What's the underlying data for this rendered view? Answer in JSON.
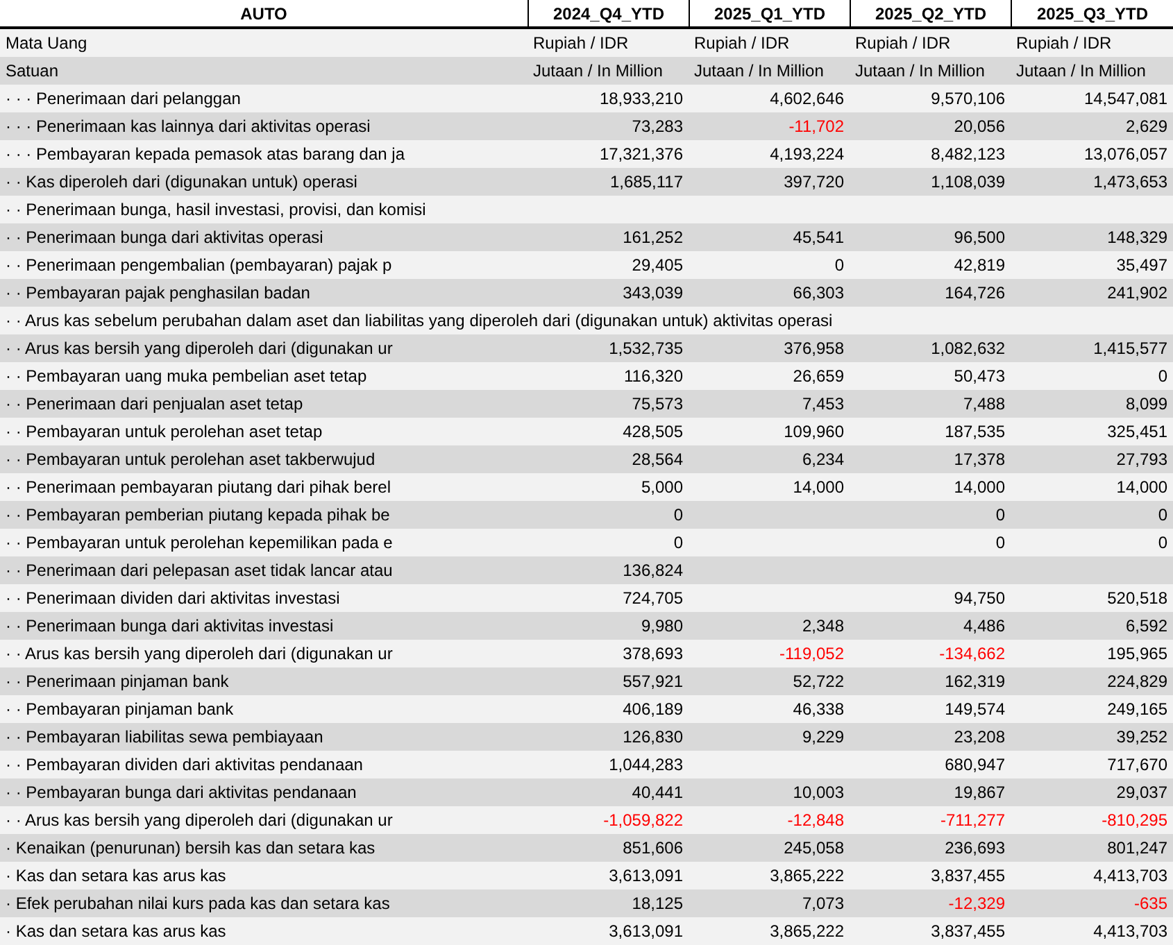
{
  "table": {
    "columns": [
      "AUTO",
      "2024_Q4_YTD",
      "2025_Q1_YTD",
      "2025_Q2_YTD",
      "2025_Q3_YTD"
    ],
    "meta_rows": [
      {
        "label": "Mata Uang",
        "values": [
          "Rupiah / IDR",
          "Rupiah / IDR",
          "Rupiah / IDR",
          "Rupiah / IDR"
        ]
      },
      {
        "label": "Satuan",
        "values": [
          "Jutaan / In Million",
          "Jutaan / In Million",
          "Jutaan / In Million",
          "Jutaan / In Million"
        ]
      }
    ],
    "rows": [
      {
        "label": "· · · Penerimaan dari pelanggan",
        "values": {
          "column_1": {
            "text": "18,933,210",
            "negative": false
          },
          "column_2": {
            "text": "4,602,646",
            "negative": false
          },
          "column_3": {
            "text": "9,570,106",
            "negative": false
          },
          "column_4": {
            "text": "14,547,081",
            "negative": false
          }
        }
      },
      {
        "label": "· · · Penerimaan kas lainnya dari aktivitas operasi",
        "values": {
          "column_1": {
            "text": "73,283",
            "negative": false
          },
          "column_2": {
            "text": "-11,702",
            "negative": true
          },
          "column_3": {
            "text": "20,056",
            "negative": false
          },
          "column_4": {
            "text": "2,629",
            "negative": false
          }
        }
      },
      {
        "label": "· · · Pembayaran kepada pemasok atas barang dan ja",
        "values": {
          "column_1": {
            "text": "17,321,376",
            "negative": false
          },
          "column_2": {
            "text": "4,193,224",
            "negative": false
          },
          "column_3": {
            "text": "8,482,123",
            "negative": false
          },
          "column_4": {
            "text": "13,076,057",
            "negative": false
          }
        }
      },
      {
        "label": "· · Kas diperoleh dari (digunakan untuk) operasi",
        "values": {
          "column_1": {
            "text": "1,685,117",
            "negative": false
          },
          "column_2": {
            "text": "397,720",
            "negative": false
          },
          "column_3": {
            "text": "1,108,039",
            "negative": false
          },
          "column_4": {
            "text": "1,473,653",
            "negative": false
          }
        }
      },
      {
        "label": "· · Penerimaan bunga, hasil investasi, provisi, dan komisi"
      },
      {
        "label": "· · Penerimaan bunga dari aktivitas operasi",
        "values": {
          "column_1": {
            "text": "161,252",
            "negative": false
          },
          "column_2": {
            "text": "45,541",
            "negative": false
          },
          "column_3": {
            "text": "96,500",
            "negative": false
          },
          "column_4": {
            "text": "148,329",
            "negative": false
          }
        }
      },
      {
        "label": "· · Penerimaan pengembalian (pembayaran) pajak p",
        "values": {
          "column_1": {
            "text": "29,405",
            "negative": false
          },
          "column_2": {
            "text": "0",
            "negative": false
          },
          "column_3": {
            "text": "42,819",
            "negative": false
          },
          "column_4": {
            "text": "35,497",
            "negative": false
          }
        }
      },
      {
        "label": "· · Pembayaran pajak penghasilan badan",
        "values": {
          "column_1": {
            "text": "343,039",
            "negative": false
          },
          "column_2": {
            "text": "66,303",
            "negative": false
          },
          "column_3": {
            "text": "164,726",
            "negative": false
          },
          "column_4": {
            "text": "241,902",
            "negative": false
          }
        }
      },
      {
        "label": "· · Arus kas sebelum perubahan dalam aset dan liabilitas yang diperoleh dari (digunakan untuk) aktivitas operasi"
      },
      {
        "label": "· · Arus kas bersih yang diperoleh dari (digunakan ur",
        "values": {
          "column_1": {
            "text": "1,532,735",
            "negative": false
          },
          "column_2": {
            "text": "376,958",
            "negative": false
          },
          "column_3": {
            "text": "1,082,632",
            "negative": false
          },
          "column_4": {
            "text": "1,415,577",
            "negative": false
          }
        }
      },
      {
        "label": "· · Pembayaran uang muka pembelian aset tetap",
        "values": {
          "column_1": {
            "text": "116,320",
            "negative": false
          },
          "column_2": {
            "text": "26,659",
            "negative": false
          },
          "column_3": {
            "text": "50,473",
            "negative": false
          },
          "column_4": {
            "text": "0",
            "negative": false
          }
        }
      },
      {
        "label": "· · Penerimaan dari penjualan aset tetap",
        "values": {
          "column_1": {
            "text": "75,573",
            "negative": false
          },
          "column_2": {
            "text": "7,453",
            "negative": false
          },
          "column_3": {
            "text": "7,488",
            "negative": false
          },
          "column_4": {
            "text": "8,099",
            "negative": false
          }
        }
      },
      {
        "label": "· · Pembayaran untuk perolehan aset tetap",
        "values": {
          "column_1": {
            "text": "428,505",
            "negative": false
          },
          "column_2": {
            "text": "109,960",
            "negative": false
          },
          "column_3": {
            "text": "187,535",
            "negative": false
          },
          "column_4": {
            "text": "325,451",
            "negative": false
          }
        }
      },
      {
        "label": "· · Pembayaran untuk perolehan aset takberwujud",
        "values": {
          "column_1": {
            "text": "28,564",
            "negative": false
          },
          "column_2": {
            "text": "6,234",
            "negative": false
          },
          "column_3": {
            "text": "17,378",
            "negative": false
          },
          "column_4": {
            "text": "27,793",
            "negative": false
          }
        }
      },
      {
        "label": "· · Penerimaan pembayaran piutang dari pihak berel",
        "values": {
          "column_1": {
            "text": "5,000",
            "negative": false
          },
          "column_2": {
            "text": "14,000",
            "negative": false
          },
          "column_3": {
            "text": "14,000",
            "negative": false
          },
          "column_4": {
            "text": "14,000",
            "negative": false
          }
        }
      },
      {
        "label": "· · Pembayaran pemberian piutang kepada pihak be",
        "values": {
          "column_1": {
            "text": "0",
            "negative": false
          },
          "column_3": {
            "text": "0",
            "negative": false
          },
          "column_4": {
            "text": "0",
            "negative": false
          }
        }
      },
      {
        "label": "· · Pembayaran untuk perolehan kepemilikan pada e",
        "values": {
          "column_1": {
            "text": "0",
            "negative": false
          },
          "column_3": {
            "text": "0",
            "negative": false
          },
          "column_4": {
            "text": "0",
            "negative": false
          }
        }
      },
      {
        "label": "· · Penerimaan dari pelepasan aset tidak lancar atau",
        "values": {
          "column_1": {
            "text": "136,824",
            "negative": false
          }
        }
      },
      {
        "label": "· · Penerimaan dividen dari aktivitas investasi",
        "values": {
          "column_1": {
            "text": "724,705",
            "negative": false
          },
          "column_3": {
            "text": "94,750",
            "negative": false
          },
          "column_4": {
            "text": "520,518",
            "negative": false
          }
        }
      },
      {
        "label": "· · Penerimaan bunga dari aktivitas investasi",
        "values": {
          "column_1": {
            "text": "9,980",
            "negative": false
          },
          "column_2": {
            "text": "2,348",
            "negative": false
          },
          "column_3": {
            "text": "4,486",
            "negative": false
          },
          "column_4": {
            "text": "6,592",
            "negative": false
          }
        }
      },
      {
        "label": "· · Arus kas bersih yang diperoleh dari (digunakan ur",
        "values": {
          "column_1": {
            "text": "378,693",
            "negative": false
          },
          "column_2": {
            "text": "-119,052",
            "negative": true
          },
          "column_3": {
            "text": "-134,662",
            "negative": true
          },
          "column_4": {
            "text": "195,965",
            "negative": false
          }
        }
      },
      {
        "label": "· · Penerimaan pinjaman bank",
        "values": {
          "column_1": {
            "text": "557,921",
            "negative": false
          },
          "column_2": {
            "text": "52,722",
            "negative": false
          },
          "column_3": {
            "text": "162,319",
            "negative": false
          },
          "column_4": {
            "text": "224,829",
            "negative": false
          }
        }
      },
      {
        "label": "· · Pembayaran pinjaman bank",
        "values": {
          "column_1": {
            "text": "406,189",
            "negative": false
          },
          "column_2": {
            "text": "46,338",
            "negative": false
          },
          "column_3": {
            "text": "149,574",
            "negative": false
          },
          "column_4": {
            "text": "249,165",
            "negative": false
          }
        }
      },
      {
        "label": "· · Pembayaran liabilitas sewa pembiayaan",
        "values": {
          "column_1": {
            "text": "126,830",
            "negative": false
          },
          "column_2": {
            "text": "9,229",
            "negative": false
          },
          "column_3": {
            "text": "23,208",
            "negative": false
          },
          "column_4": {
            "text": "39,252",
            "negative": false
          }
        }
      },
      {
        "label": "· · Pembayaran dividen dari aktivitas pendanaan",
        "values": {
          "column_1": {
            "text": "1,044,283",
            "negative": false
          },
          "column_3": {
            "text": "680,947",
            "negative": false
          },
          "column_4": {
            "text": "717,670",
            "negative": false
          }
        }
      },
      {
        "label": "· · Pembayaran bunga dari aktivitas pendanaan",
        "values": {
          "column_1": {
            "text": "40,441",
            "negative": false
          },
          "column_2": {
            "text": "10,003",
            "negative": false
          },
          "column_3": {
            "text": "19,867",
            "negative": false
          },
          "column_4": {
            "text": "29,037",
            "negative": false
          }
        }
      },
      {
        "label": "· · Arus kas bersih yang diperoleh dari (digunakan ur",
        "values": {
          "column_1": {
            "text": "-1,059,822",
            "negative": true
          },
          "column_2": {
            "text": "-12,848",
            "negative": true
          },
          "column_3": {
            "text": "-711,277",
            "negative": true
          },
          "column_4": {
            "text": "-810,295",
            "negative": true
          }
        }
      },
      {
        "label": "· Kenaikan (penurunan) bersih kas dan setara kas",
        "values": {
          "column_1": {
            "text": "851,606",
            "negative": false
          },
          "column_2": {
            "text": "245,058",
            "negative": false
          },
          "column_3": {
            "text": "236,693",
            "negative": false
          },
          "column_4": {
            "text": "801,247",
            "negative": false
          }
        }
      },
      {
        "label": "· Kas dan setara kas arus kas",
        "values": {
          "column_1": {
            "text": "3,613,091",
            "negative": false
          },
          "column_2": {
            "text": "3,865,222",
            "negative": false
          },
          "column_3": {
            "text": "3,837,455",
            "negative": false
          },
          "column_4": {
            "text": "4,413,703",
            "negative": false
          }
        }
      },
      {
        "label": "· Efek perubahan nilai kurs pada kas dan setara kas",
        "values": {
          "column_1": {
            "text": "18,125",
            "negative": false
          },
          "column_2": {
            "text": "7,073",
            "negative": false
          },
          "column_3": {
            "text": "-12,329",
            "negative": true
          },
          "column_4": {
            "text": "-635",
            "negative": true
          }
        }
      },
      {
        "label": "· Kas dan setara kas arus kas",
        "values": {
          "column_1": {
            "text": "3,613,091",
            "negative": false
          },
          "column_2": {
            "text": "3,865,222",
            "negative": false
          },
          "column_3": {
            "text": "3,837,455",
            "negative": false
          },
          "column_4": {
            "text": "4,413,703",
            "negative": false
          }
        }
      }
    ]
  }
}
